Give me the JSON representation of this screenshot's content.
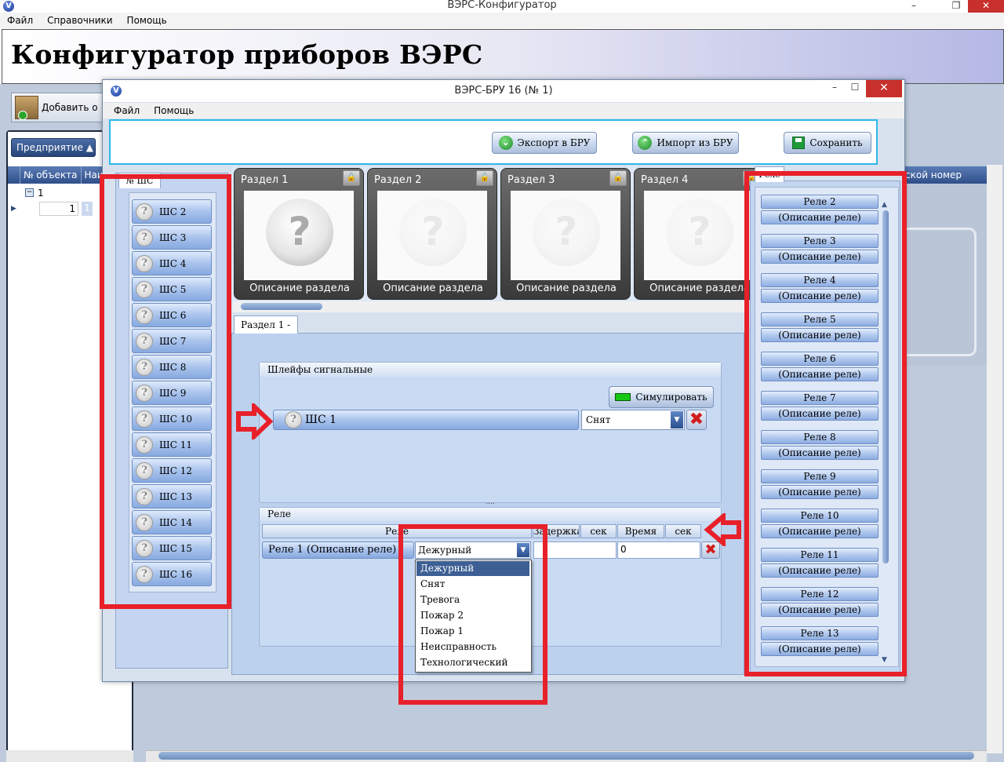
{
  "outer": {
    "title": "ВЭРС-Конфигуратор",
    "menu": [
      "Файл",
      "Справочники",
      "Помощь"
    ],
    "header_title": "Конфигуратор приборов ВЭРС",
    "add_button": "Добавить о",
    "enterprise_tab": "Предприятие",
    "grid_headers": [
      "№ объекта",
      "Наи"
    ],
    "grid_row1": "1",
    "grid_row2_val1": "1",
    "grid_row2_val2": "1",
    "right_header": "ской номер"
  },
  "dialog": {
    "title": "ВЭРС-БРУ 16 (№ 1)",
    "menu": [
      "Файл",
      "Помощь"
    ],
    "toolbar": {
      "export": "Экспорт в БРУ",
      "import": "Импорт из БРУ",
      "save": "Сохранить"
    },
    "shc_tab": "№ ШС",
    "shc_items": [
      "ШС 2",
      "ШС 3",
      "ШС 4",
      "ШС 5",
      "ШС 6",
      "ШС 7",
      "ШС 8",
      "ШС 9",
      "ШС 10",
      "ШС 11",
      "ШС 12",
      "ШС 13",
      "ШС 14",
      "ШС 15",
      "ШС 16"
    ],
    "razdels": [
      {
        "title": "Раздел 1",
        "desc": "Описание раздела"
      },
      {
        "title": "Раздел 2",
        "desc": "Описание раздела"
      },
      {
        "title": "Раздел 3",
        "desc": "Описание раздела"
      },
      {
        "title": "Раздел 4",
        "desc": "Описание раздела"
      }
    ],
    "razdel_tab": "Раздел 1 -",
    "shleify": {
      "header": "Шлейфы сигнальные",
      "simulate": "Симулировать",
      "row_label": "ШС 1",
      "state": "Снят"
    },
    "rele": {
      "header": "Реле",
      "columns": [
        "Реле",
        "Задержка",
        "сек",
        "Время",
        "сек"
      ],
      "row_label": "Реле 1 (Описание реле)",
      "mode": "Дежурный",
      "time_value": "0",
      "dropdown": [
        "Дежурный",
        "Снят",
        "Тревога",
        "Пожар 2",
        "Пожар 1",
        "Неисправность",
        "Технологический"
      ]
    },
    "rele_tab": "Реле",
    "rele_items": [
      {
        "name": "Реле 2",
        "desc": "(Описание реле)"
      },
      {
        "name": "Реле 3",
        "desc": "(Описание реле)"
      },
      {
        "name": "Реле 4",
        "desc": "(Описание реле)"
      },
      {
        "name": "Реле 5",
        "desc": "(Описание реле)"
      },
      {
        "name": "Реле 6",
        "desc": "(Описание реле)"
      },
      {
        "name": "Реле 7",
        "desc": "(Описание реле)"
      },
      {
        "name": "Реле 8",
        "desc": "(Описание реле)"
      },
      {
        "name": "Реле 9",
        "desc": "(Описание реле)"
      },
      {
        "name": "Реле 10",
        "desc": "(Описание реле)"
      },
      {
        "name": "Реле 11",
        "desc": "(Описание реле)"
      },
      {
        "name": "Реле 12",
        "desc": "(Описание реле)"
      },
      {
        "name": "Реле 13",
        "desc": "(Описание реле)"
      }
    ]
  },
  "colors": {
    "annotation_red": "#e8202a",
    "close_red": "#c7302c",
    "toolbar_border": "#2db8e8"
  }
}
